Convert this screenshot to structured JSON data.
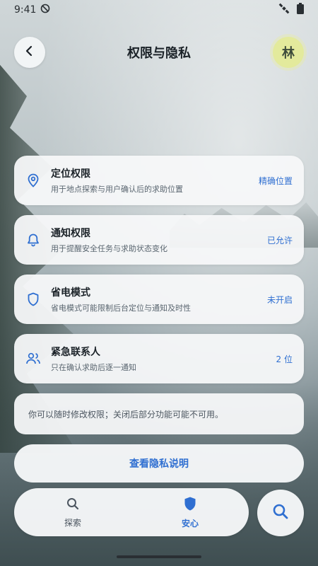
{
  "status": {
    "time": "9:41"
  },
  "header": {
    "title": "权限与隐私",
    "avatar_text": "林"
  },
  "permissions": [
    {
      "title": "定位权限",
      "subtitle": "用于地点探索与用户确认后的求助位置",
      "value": "精确位置",
      "icon": "location-pin-icon"
    },
    {
      "title": "通知权限",
      "subtitle": "用于提醒安全任务与求助状态变化",
      "value": "已允许",
      "icon": "bell-icon"
    },
    {
      "title": "省电模式",
      "subtitle": "省电模式可能限制后台定位与通知及时性",
      "value": "未开启",
      "icon": "shield-icon"
    },
    {
      "title": "紧急联系人",
      "subtitle": "只在确认求助后逐一通知",
      "value": "2 位",
      "icon": "people-icon"
    }
  ],
  "note": "你可以随时修改权限；关闭后部分功能可能不可用。",
  "privacy_button": "查看隐私说明",
  "nav": {
    "explore_label": "探索",
    "safety_label": "安心",
    "active": "安心"
  },
  "colors": {
    "accent": "#2f6fd1",
    "avatar_bg": "#e3ea9c"
  }
}
